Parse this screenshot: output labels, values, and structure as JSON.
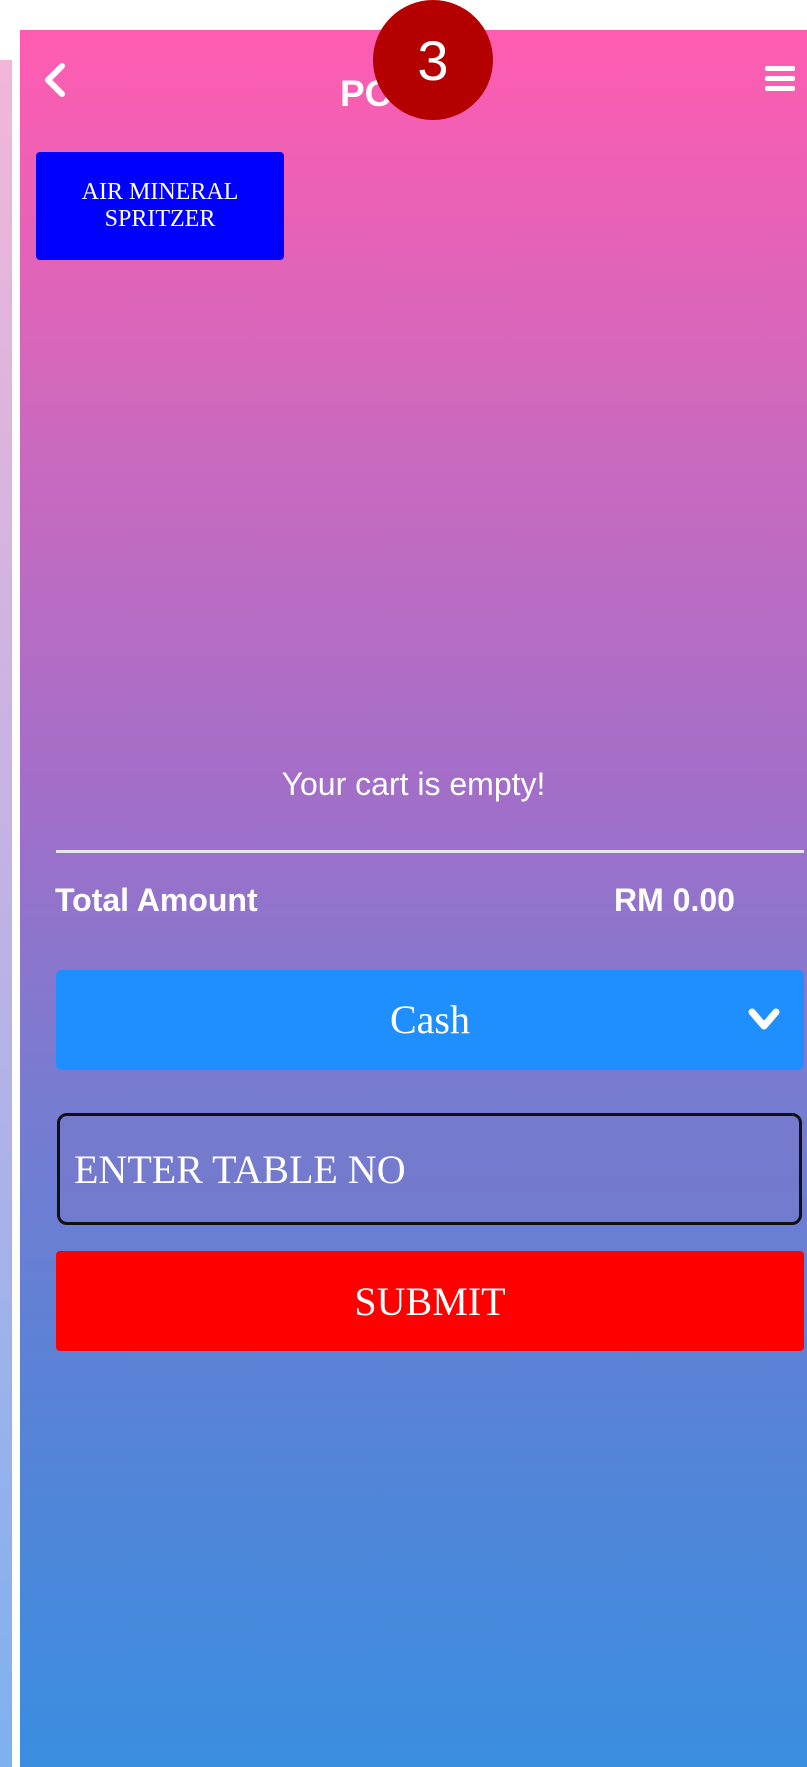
{
  "header": {
    "title": "POS",
    "back_icon": "chevron-left-icon",
    "menu_icon": "hamburger-menu-icon"
  },
  "step_badge": "3",
  "products": [
    {
      "label": "AIR MINERAL SPRITZER",
      "color": "#0000ff"
    }
  ],
  "cart": {
    "empty_message": "Your cart is empty!",
    "total_label": "Total Amount",
    "total_value": "RM 0.00"
  },
  "payment": {
    "selected": "Cash",
    "icon": "chevron-down-icon",
    "color": "#1f8fff"
  },
  "table_input": {
    "value": "",
    "placeholder": "ENTER TABLE NO"
  },
  "submit": {
    "label": "SUBMIT",
    "color": "#ff0000"
  },
  "colors": {
    "gradient_top": "#ff5cb0",
    "gradient_bottom": "#3a8ee0",
    "badge": "#b50000"
  }
}
